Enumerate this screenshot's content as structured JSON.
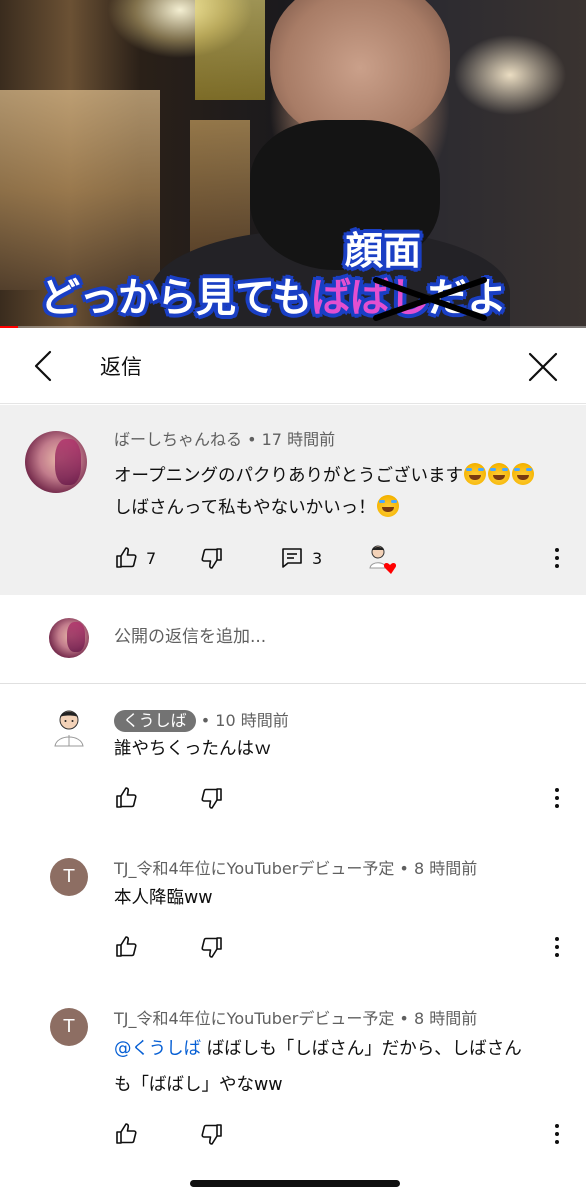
{
  "video": {
    "caption_main": "どっから見ても",
    "caption_struck": "ばばし",
    "caption_end": "だよ",
    "caption_correction": "顔面",
    "progress_fraction": 0.03
  },
  "header": {
    "title": "返信"
  },
  "parent_comment": {
    "author": "ばーしちゃんねる",
    "time": " • 17 時間前",
    "line1": "オープニングのパクりありがとうございます",
    "line2": "しばさんって私もやないかいっ！",
    "likes": "7",
    "replies": "3"
  },
  "add_reply": {
    "placeholder": "公開の返信を追加..."
  },
  "replies": [
    {
      "avatar_letter": "",
      "author": "くうしば",
      "time": " • 10 時間前",
      "text": "誰やちくったんはｗ"
    },
    {
      "avatar_letter": "T",
      "author": "TJ_令和4年位にYouTuberデビュー予定",
      "time": " • 8 時間前",
      "text": "本人降臨ww"
    },
    {
      "avatar_letter": "T",
      "author": "TJ_令和4年位にYouTuberデビュー予定",
      "time": " • 8 時間前",
      "mention": "@くうしば",
      "text_line1": "  ばばしも「しばさん」だから、しばさん",
      "text_line2": "も「ばばし」やなww"
    }
  ],
  "colors": {
    "heart": "#ff0000",
    "mention": "#065fd4",
    "letter_avatar": "#8d6e63",
    "caption_outline": "#1a3fc4",
    "caption_struck": "#e34fd0"
  }
}
